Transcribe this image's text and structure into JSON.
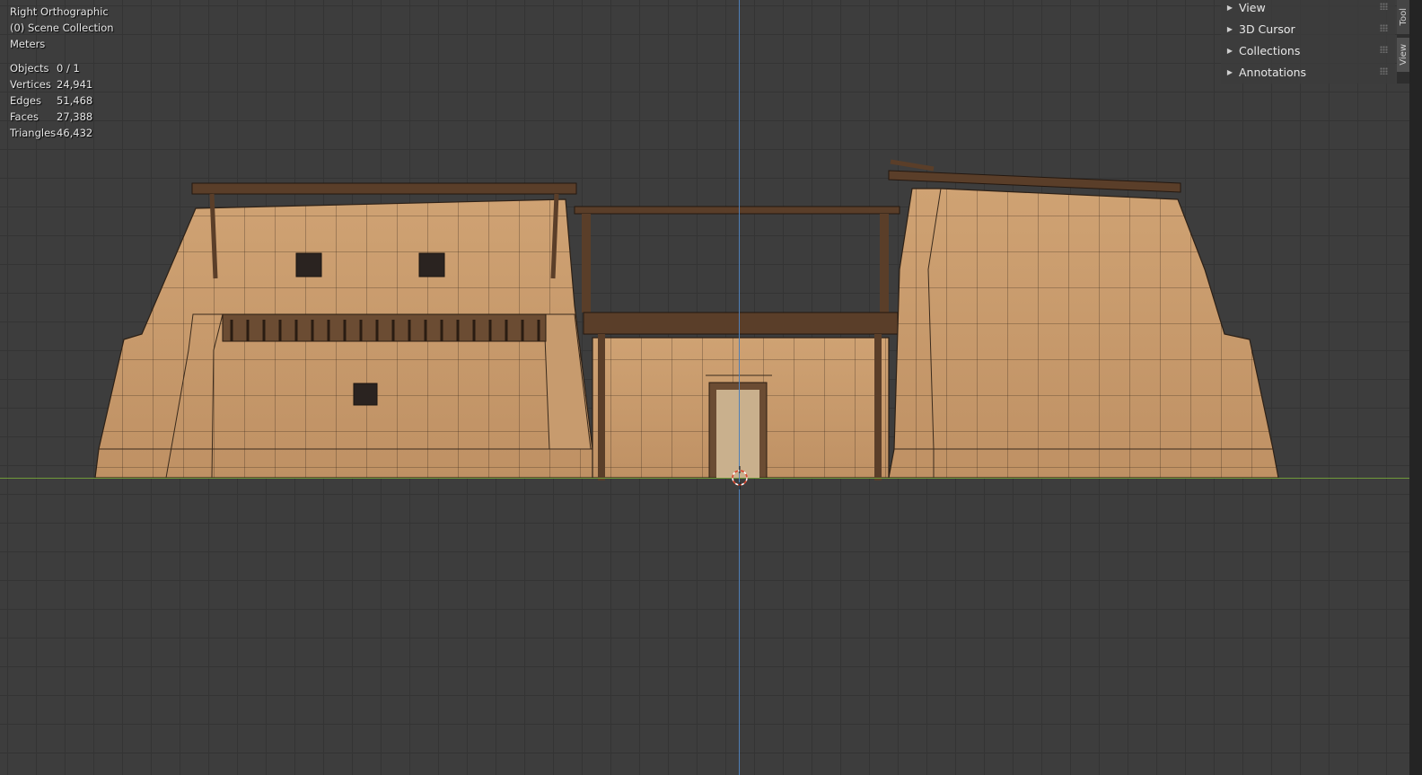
{
  "viewport": {
    "view_name": "Right Orthographic",
    "collection": "(0) Scene Collection",
    "units": "Meters",
    "stats": [
      {
        "label": "Objects",
        "value": "0 / 1"
      },
      {
        "label": "Vertices",
        "value": "24,941"
      },
      {
        "label": "Edges",
        "value": "51,468"
      },
      {
        "label": "Faces",
        "value": "27,388"
      },
      {
        "label": "Triangles",
        "value": "46,432"
      }
    ]
  },
  "sidebar": {
    "panels": [
      {
        "label": "View"
      },
      {
        "label": "3D Cursor"
      },
      {
        "label": "Collections"
      },
      {
        "label": "Annotations"
      }
    ],
    "tabs": [
      {
        "label": "Tool"
      },
      {
        "label": "View"
      }
    ]
  },
  "colors": {
    "grid_bg": "#3d3d3d",
    "x_axis": "#6f9a3a",
    "z_axis": "#4f7fb8",
    "wall": "#c89a6c",
    "wood": "#4a3222"
  }
}
